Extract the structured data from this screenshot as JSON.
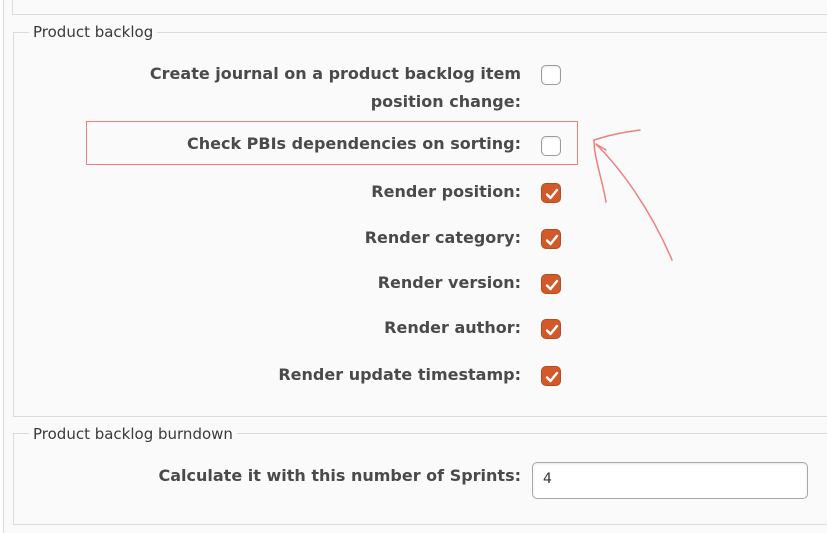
{
  "product_backlog": {
    "legend": "Product backlog",
    "settings": [
      {
        "label_line1": "Create journal on a product backlog item",
        "label_line2": "position change:",
        "checked": false
      },
      {
        "label": "Check PBIs dependencies on sorting:",
        "checked": false
      },
      {
        "label": "Render position:",
        "checked": true
      },
      {
        "label": "Render category:",
        "checked": true
      },
      {
        "label": "Render version:",
        "checked": true
      },
      {
        "label": "Render author:",
        "checked": true
      },
      {
        "label": "Render update timestamp:",
        "checked": true
      }
    ]
  },
  "product_backlog_burndown": {
    "legend": "Product backlog burndown",
    "sprints_label": "Calculate it with this number of Sprints:",
    "sprints_value": "4"
  },
  "colors": {
    "checkbox_checked": "#d2592a",
    "annotation": "#ef7f7f"
  }
}
